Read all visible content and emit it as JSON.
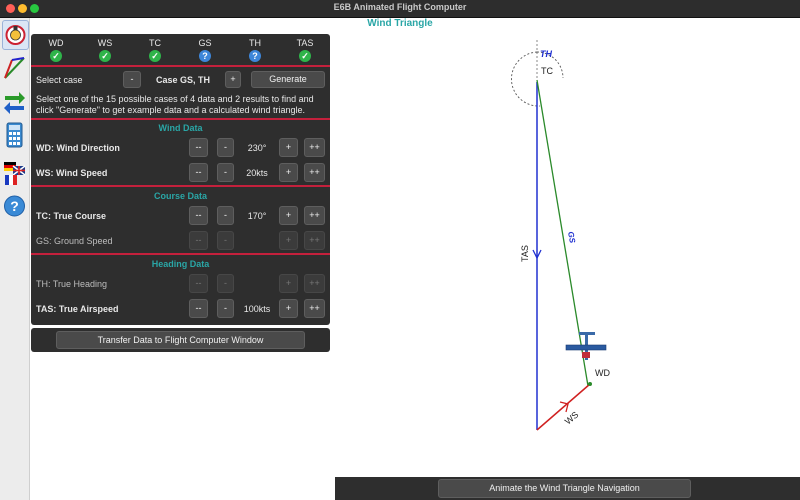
{
  "window": {
    "title": "E6B Animated Flight Computer"
  },
  "canvas_title": "Wind Triangle",
  "status": [
    {
      "label": "WD",
      "state": "ok",
      "glyph": "✓"
    },
    {
      "label": "WS",
      "state": "ok",
      "glyph": "✓"
    },
    {
      "label": "TC",
      "state": "ok",
      "glyph": "✓"
    },
    {
      "label": "GS",
      "state": "unknown",
      "glyph": "?"
    },
    {
      "label": "TH",
      "state": "unknown",
      "glyph": "?"
    },
    {
      "label": "TAS",
      "state": "ok",
      "glyph": "✓"
    }
  ],
  "case": {
    "label": "Select case",
    "minus": "-",
    "value": "Case GS, TH",
    "plus": "+",
    "generate": "Generate",
    "help_line1": "Select one of the 15 possible cases of 4 data and 2 results to find and",
    "help_line2": "click \"Generate\" to get example data and a calculated wind triangle."
  },
  "sections": {
    "wind": "Wind Data",
    "course": "Course Data",
    "heading": "Heading Data"
  },
  "steppers": {
    "dec_big": "--",
    "dec": "-",
    "inc": "+",
    "inc_big": "++"
  },
  "rows": {
    "wd": {
      "label": "WD: Wind Direction",
      "value": "230°"
    },
    "ws": {
      "label": "WS: Wind Speed",
      "value": "20kts"
    },
    "tc": {
      "label": "TC: True Course",
      "value": "170°"
    },
    "gs": {
      "label": "GS: Ground Speed",
      "value": ""
    },
    "th": {
      "label": "TH: True Heading",
      "value": ""
    },
    "tas": {
      "label": "TAS: True Airspeed",
      "value": "100kts"
    }
  },
  "transfer": "Transfer Data to Flight Computer Window",
  "animate": "Animate the Wind Triangle Navigation",
  "diagram": {
    "th": "TH",
    "tc": "TC",
    "gs": "GS",
    "tas": "TAS",
    "wd": "WD",
    "ws": "WS"
  },
  "colors": {
    "accent": "#2aa6a6",
    "separator": "#c4203c",
    "tas": "#2030d0",
    "gs": "#2a8a2a",
    "ws": "#d02020"
  },
  "sidebar_icons": [
    "e6b-logo-icon",
    "wind-triangle-icon",
    "transfer-arrows-icon",
    "calculator-icon",
    "language-flags-icon",
    "help-icon"
  ]
}
